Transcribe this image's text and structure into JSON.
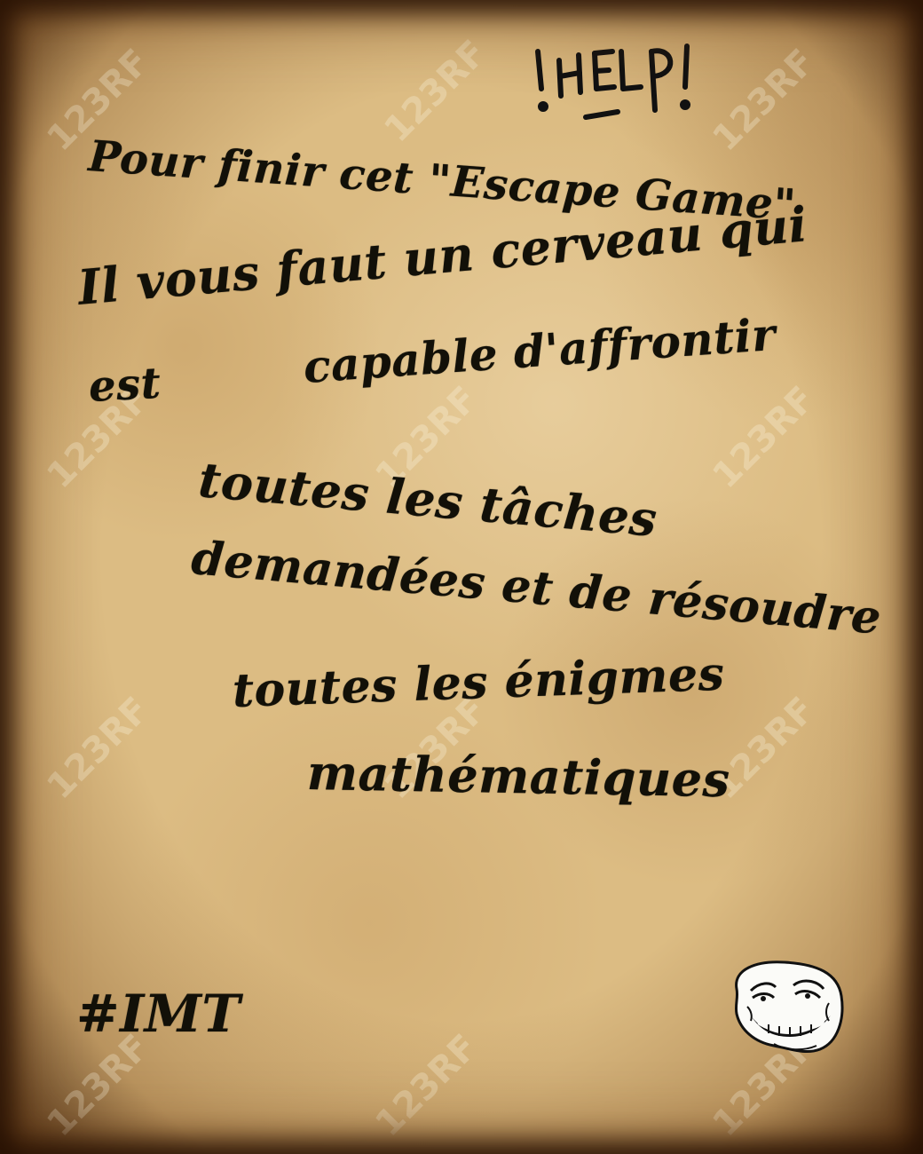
{
  "handwritten_note": "!HELP!",
  "lines": [
    "Pour finir cet \"Escape Game\"",
    "Il vous faut un cerveau qui",
    "est",
    "capable d'affrontir",
    "toutes les tâches",
    "demandées et de résoudre",
    "toutes les énigmes",
    "mathématiques"
  ],
  "signature": "#IMT",
  "watermark_text": "123RF",
  "troll_face_icon": "troll-face",
  "colors": {
    "parchment": "#dcbc83",
    "ink": "#121008",
    "burnt_edge": "#1e0e02"
  }
}
